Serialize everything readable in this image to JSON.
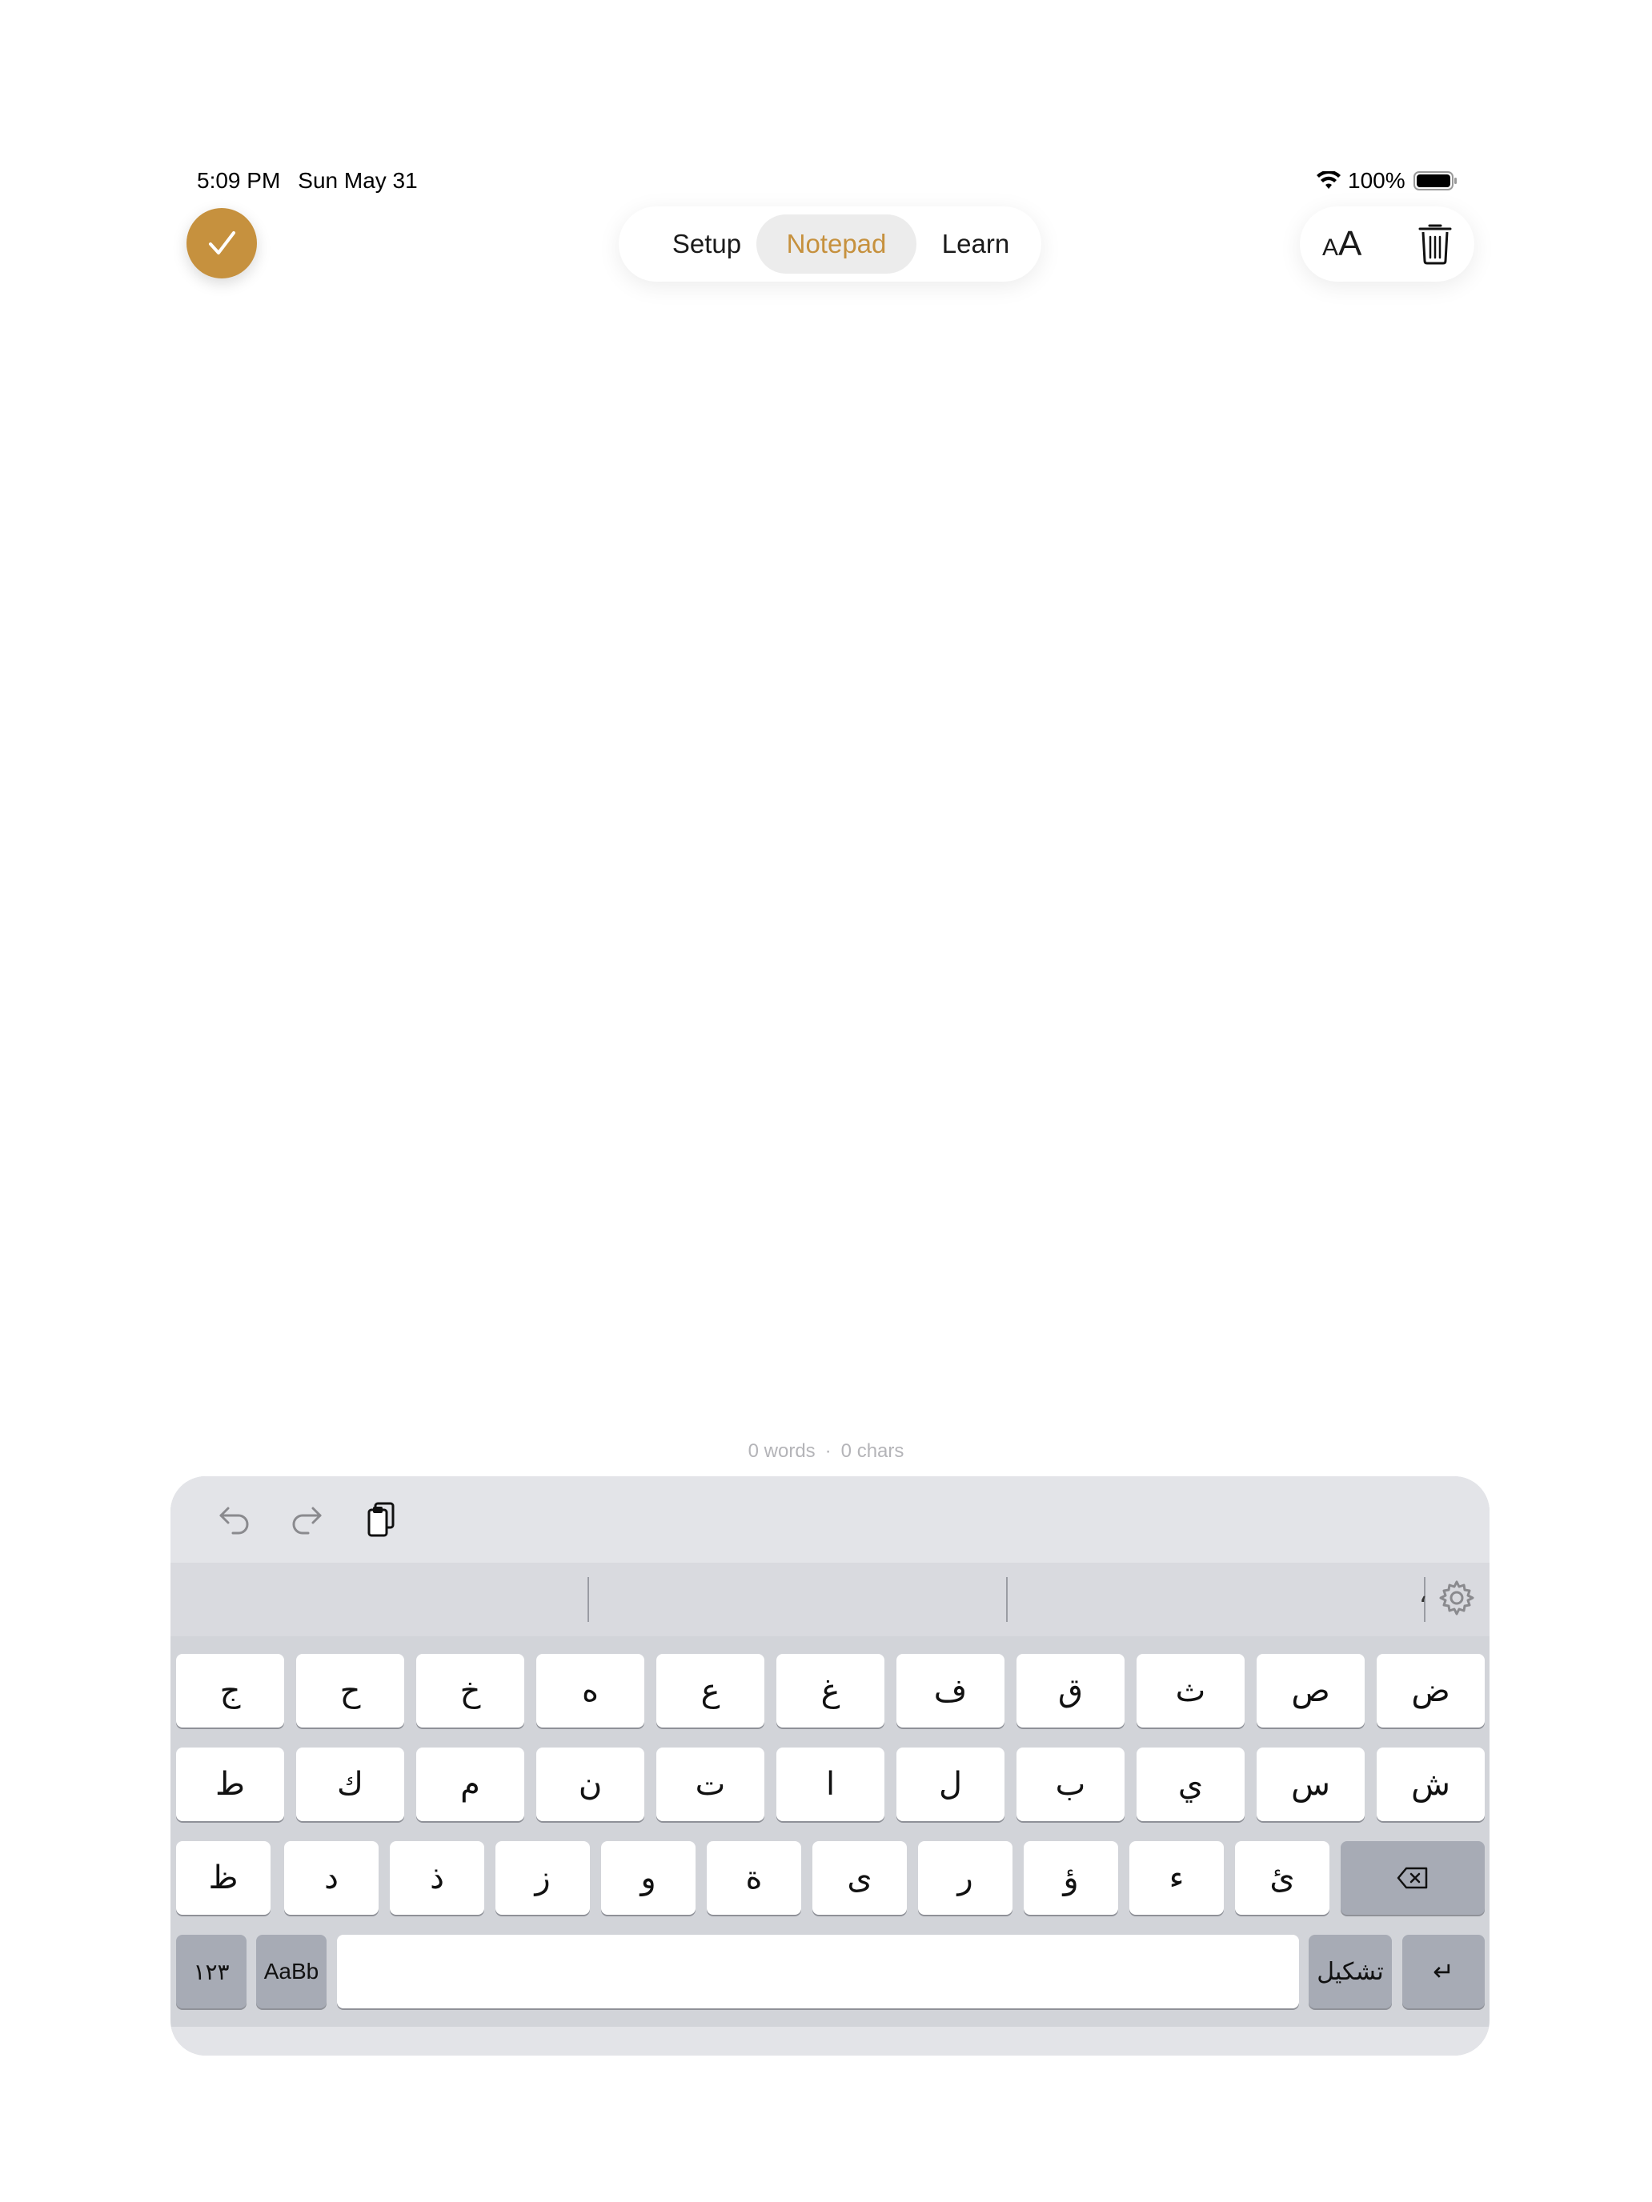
{
  "status_bar": {
    "time": "5:09 PM",
    "date": "Sun May 31",
    "battery": "100%"
  },
  "nav": {
    "tabs": [
      {
        "label": "Setup",
        "active": false
      },
      {
        "label": "Notepad",
        "active": true
      },
      {
        "label": "Learn",
        "active": false
      }
    ]
  },
  "tools": {
    "font_size_small": "A",
    "font_size_large": "A"
  },
  "counter": {
    "words": "0 words",
    "separator": "·",
    "chars": "0 chars"
  },
  "colors": {
    "accent": "#c6913e",
    "keyboard_bg": "#d2d4d9"
  },
  "keyboard": {
    "suggestion_text": "،",
    "row1": [
      "ض",
      "ص",
      "ث",
      "ق",
      "ف",
      "غ",
      "ع",
      "ه",
      "خ",
      "ح",
      "ج"
    ],
    "row2": [
      "ش",
      "س",
      "ي",
      "ب",
      "ل",
      "ا",
      "ت",
      "ن",
      "م",
      "ك",
      "ط"
    ],
    "row3": [
      "ئ",
      "ء",
      "ؤ",
      "ر",
      "ى",
      "ة",
      "و",
      "ز",
      "ذ",
      "د",
      "ظ"
    ],
    "numbers_label": "١٢٣",
    "latin_label": "AaBb",
    "tashkeel_label": "تشكيل",
    "return_label": "↵",
    "delete_icon": "delete-icon"
  }
}
